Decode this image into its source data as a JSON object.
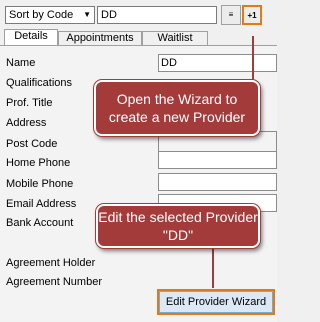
{
  "toolbar": {
    "sort_value": "Sort by Code",
    "search_value": "DD",
    "btn1_label": "≡",
    "btn2_label": "+1"
  },
  "tabs": [
    "Details",
    "Appointments",
    "Waitlist"
  ],
  "fields": {
    "name_label": "Name",
    "name_value": "DD",
    "qualifications_label": "Qualifications",
    "prof_title_label": "Prof. Title",
    "address_label": "Address",
    "post_code_label": "Post Code",
    "home_phone_label": "Home Phone",
    "mobile_phone_label": "Mobile Phone",
    "email_label": "Email Address",
    "bank_account_label": "Bank Account",
    "agreement_holder_label": "Agreement Holder",
    "agreement_number_label": "Agreement Number"
  },
  "callouts": {
    "wizard": "Open the Wizard to create a new Provider",
    "edit": "Edit the selected Provider \"DD\""
  },
  "edit_button_label": "Edit Provider Wizard",
  "colors": {
    "callout": "#a33b3b",
    "highlight": "#e07b1a"
  }
}
